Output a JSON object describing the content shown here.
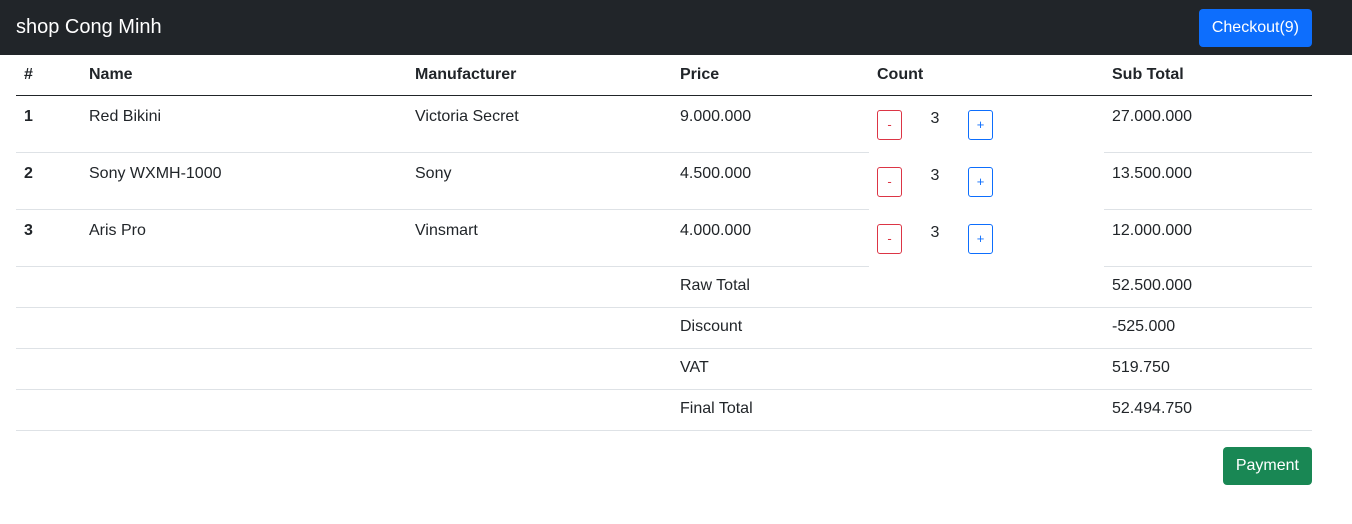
{
  "navbar": {
    "brand": "shop Cong Minh",
    "checkout_label": "Checkout(9)"
  },
  "table": {
    "headers": [
      "#",
      "Name",
      "Manufacturer",
      "Price",
      "Count",
      "Sub Total"
    ],
    "rows": [
      {
        "index": "1",
        "name": "Red Bikini",
        "manufacturer": "Victoria Secret",
        "price": "9.000.000",
        "count": "3",
        "subtotal": "27.000.000"
      },
      {
        "index": "2",
        "name": "Sony WXMH-1000",
        "manufacturer": "Sony",
        "price": "4.500.000",
        "count": "3",
        "subtotal": "13.500.000"
      },
      {
        "index": "3",
        "name": "Aris Pro",
        "manufacturer": "Vinsmart",
        "price": "4.000.000",
        "count": "3",
        "subtotal": "12.000.000"
      }
    ],
    "minus_label": "-",
    "plus_label": "+"
  },
  "totals": [
    {
      "label": "Raw Total",
      "value": "52.500.000"
    },
    {
      "label": "Discount",
      "value": "-525.000"
    },
    {
      "label": "VAT",
      "value": "519.750"
    },
    {
      "label": "Final Total",
      "value": "52.494.750"
    }
  ],
  "payment_label": "Payment",
  "colors": {
    "navbar": "#212529",
    "checkout": "#0d6efd",
    "payment": "#198754",
    "minus": "#dc3545",
    "plus": "#0d6efd"
  }
}
